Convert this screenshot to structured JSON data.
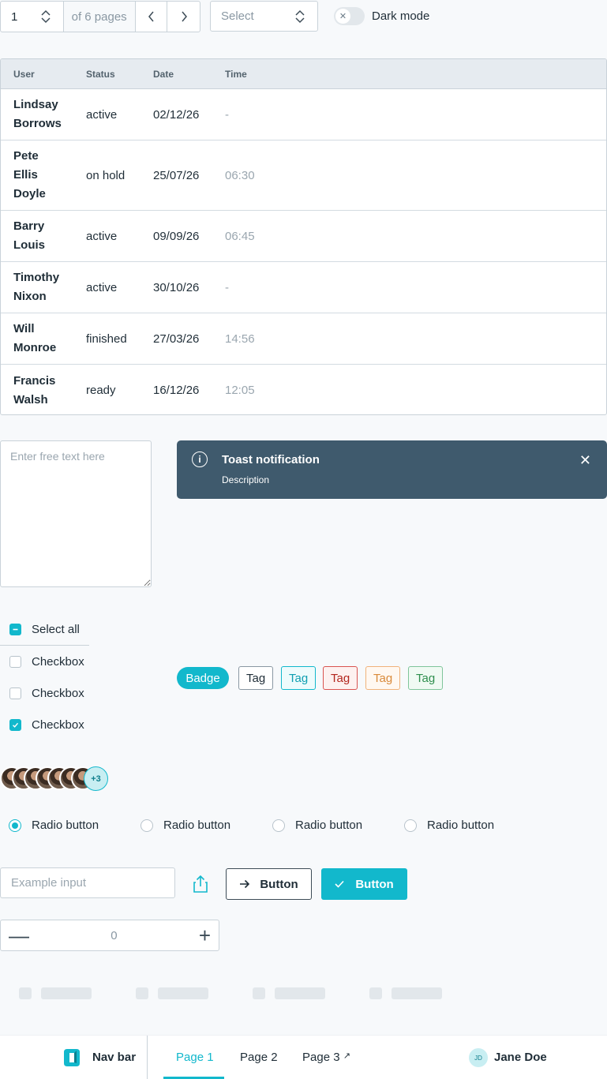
{
  "pagination": {
    "current_page": "1",
    "of_pages": "of 6 pages",
    "prev_icon": "chevron-left-icon",
    "next_icon": "chevron-right-icon"
  },
  "select": {
    "placeholder": "Select"
  },
  "dark_mode": {
    "label": "Dark mode",
    "enabled": false
  },
  "table": {
    "headers": [
      "User",
      "Status",
      "Date",
      "Time"
    ],
    "rows": [
      {
        "user": "Lindsay Borrows",
        "status": "active",
        "date": "02/12/26",
        "time": "-"
      },
      {
        "user": "Pete Ellis Doyle",
        "status": "on hold",
        "date": "25/07/26",
        "time": "06:30"
      },
      {
        "user": "Barry Louis",
        "status": "active",
        "date": "09/09/26",
        "time": "06:45"
      },
      {
        "user": "Timothy Nixon",
        "status": "active",
        "date": "30/10/26",
        "time": "-"
      },
      {
        "user": "Will Monroe",
        "status": "finished",
        "date": "27/03/26",
        "time": "14:56"
      },
      {
        "user": "Francis Walsh",
        "status": "ready",
        "date": "16/12/26",
        "time": "12:05"
      }
    ]
  },
  "textarea": {
    "placeholder": "Enter free text here"
  },
  "toast": {
    "title": "Toast notification",
    "description": "Description",
    "close_symbol": "✕"
  },
  "checkboxes": {
    "select_all": "Select all",
    "items": [
      {
        "label": "Checkbox",
        "checked": false
      },
      {
        "label": "Checkbox",
        "checked": false
      },
      {
        "label": "Checkbox",
        "checked": true
      }
    ]
  },
  "badge": {
    "label": "Badge"
  },
  "tags": [
    {
      "label": "Tag",
      "color": "#1f2d37",
      "border": "#8a98a3",
      "bg": "#ffffff"
    },
    {
      "label": "Tag",
      "color": "#0f9fb1",
      "border": "#12b8cc",
      "bg": "#eefbfc"
    },
    {
      "label": "Tag",
      "color": "#b3261e",
      "border": "#d9534f",
      "bg": "#fdf1f0"
    },
    {
      "label": "Tag",
      "color": "#d98a3a",
      "border": "#f0b27a",
      "bg": "#fff8f1"
    },
    {
      "label": "Tag",
      "color": "#2f8f4e",
      "border": "#7fc59a",
      "bg": "#f0faf3"
    }
  ],
  "avatars": {
    "more_label": "+3"
  },
  "radios": [
    {
      "label": "Radio button",
      "selected": true
    },
    {
      "label": "Radio button",
      "selected": false
    },
    {
      "label": "Radio button",
      "selected": false
    },
    {
      "label": "Radio button",
      "selected": false
    }
  ],
  "input": {
    "placeholder": "Example input"
  },
  "buttons": {
    "secondary_label": "Button",
    "primary_label": "Button"
  },
  "stepper": {
    "value": "0",
    "minus": "—",
    "plus": "+"
  },
  "navbar": {
    "brand": "Nav bar",
    "links": [
      "Page 1",
      "Page 2",
      "Page 3"
    ],
    "external_marker": "↗",
    "user_initials": "JD",
    "user_name": "Jane Doe"
  },
  "colors": {
    "accent": "#12b8cc",
    "toast_bg": "#3f5a6d"
  }
}
